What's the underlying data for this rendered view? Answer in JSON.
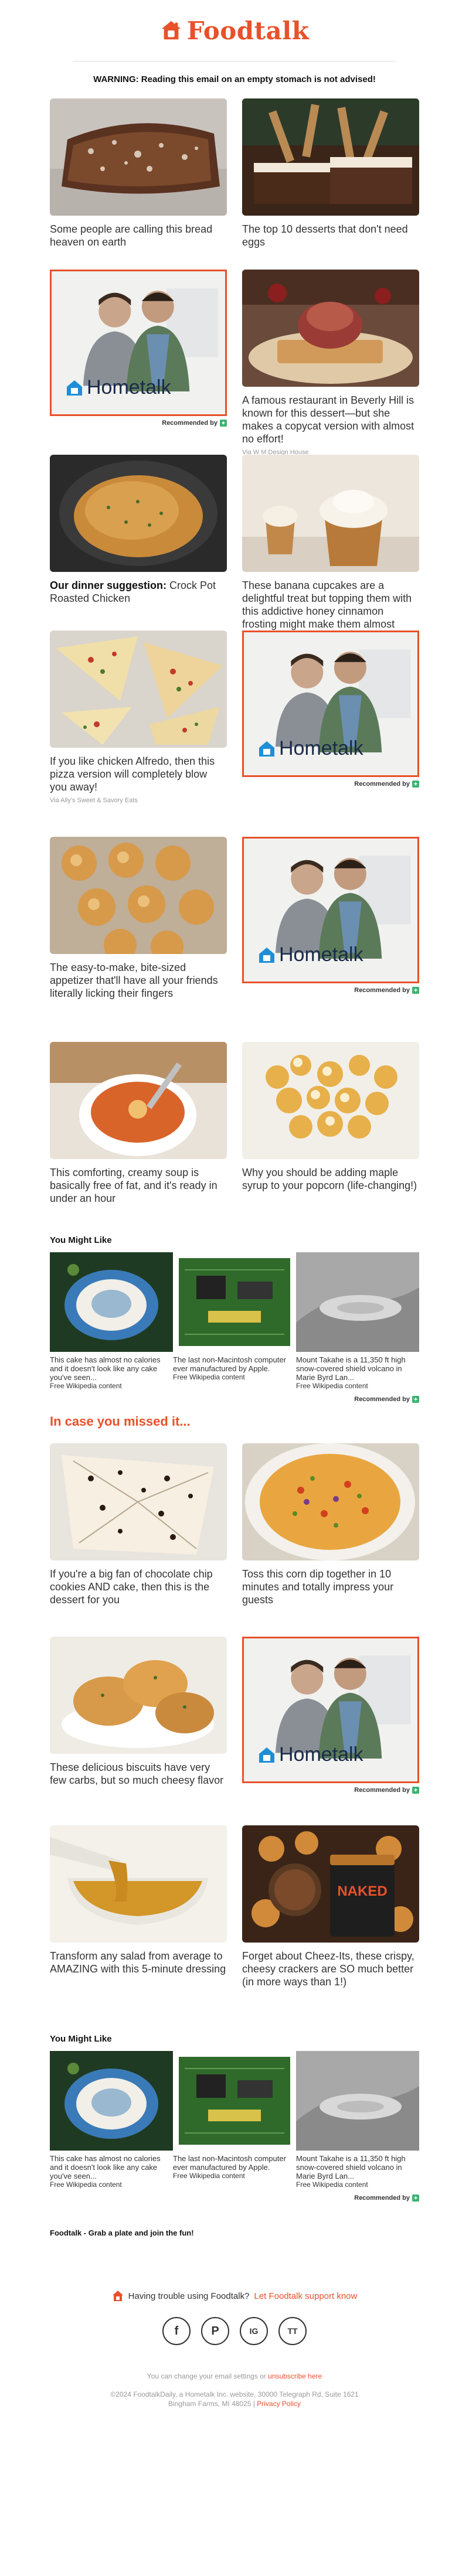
{
  "header": {
    "brand": "Foodtalk",
    "warning": "WARNING: Reading this email on an empty stomach is not advised!"
  },
  "ad": {
    "brand": "Hometalk",
    "recommended": "Recommended by"
  },
  "cards": {
    "c1": {
      "title": "Some people are calling this bread heaven on earth"
    },
    "c2": {
      "title": "The top 10 desserts that don't need eggs"
    },
    "c4": {
      "title": "A famous restaurant in Beverly Hill is known for this dessert—but she makes a copycat version with almost no effort!",
      "source": "Via W M Design House"
    },
    "c5": {
      "title_bold": "Our dinner suggestion:",
      "title": " Crock Pot Roasted Chicken"
    },
    "c6": {
      "title": "These banana cupcakes are a delightful treat but topping them with this addictive honey cinnamon frosting might make them almost perfect"
    },
    "c7": {
      "title": "If you like chicken Alfredo, then this pizza version will completely blow you away!",
      "source": "Via Ally's Sweet & Savory Eats"
    },
    "c9": {
      "title": "The easy-to-make, bite-sized appetizer that'll have all your friends literally licking their fingers"
    },
    "c11": {
      "title": "This comforting, creamy soup is basically free of fat, and it's ready in under an hour"
    },
    "c12": {
      "title": "Why you should be adding maple syrup to your popcorn (life-changing!)"
    },
    "m1": {
      "title": "If you're a big fan of chocolate chip cookies AND cake, then this is the dessert for you"
    },
    "m2": {
      "title": "Toss this corn dip together in 10 minutes and totally impress your guests"
    },
    "m3": {
      "title": "These delicious biscuits have very few carbs, but so much cheesy flavor"
    },
    "m5": {
      "title": "Transform any salad from average to AMAZING with this 5-minute dressing"
    },
    "m6": {
      "title": "Forget about Cheez-Its, these crispy, cheesy crackers are SO much better (in more ways than 1!)"
    }
  },
  "you_might_like": {
    "heading": "You Might Like",
    "items": [
      {
        "title": "This cake has almost no calories and it doesn't look like any cake you've seen...",
        "source": "Free Wikipedia content"
      },
      {
        "title": "The last non-Macintosh computer ever manufactured by Apple.",
        "source": "Free Wikipedia content"
      },
      {
        "title": "Mount Takahe is a 11,350 ft high snow-covered shield volcano in Marie Byrd Lan...",
        "source": "Free Wikipedia content"
      }
    ]
  },
  "missed_heading": "In case you missed it...",
  "footer": {
    "signoff": "Foodtalk - Grab a plate and join the fun!",
    "trouble_text": "Having trouble using Foodtalk?",
    "trouble_link": "Let Foodtalk support know",
    "social": [
      "f",
      "P",
      "IG",
      "TT"
    ],
    "settings_text": "You can change your email settings or",
    "unsubscribe": "unsubscribe here",
    "copyright": "©2024 FoodtalkDaily, a Hometalk Inc. website, 30000 Telegraph Rd, Suite 1621",
    "address": "Bingham Farms, MI 48025",
    "privacy": "Privacy Policy"
  },
  "colors": {
    "accent": "#e8512a",
    "badge": "#3cb371"
  }
}
